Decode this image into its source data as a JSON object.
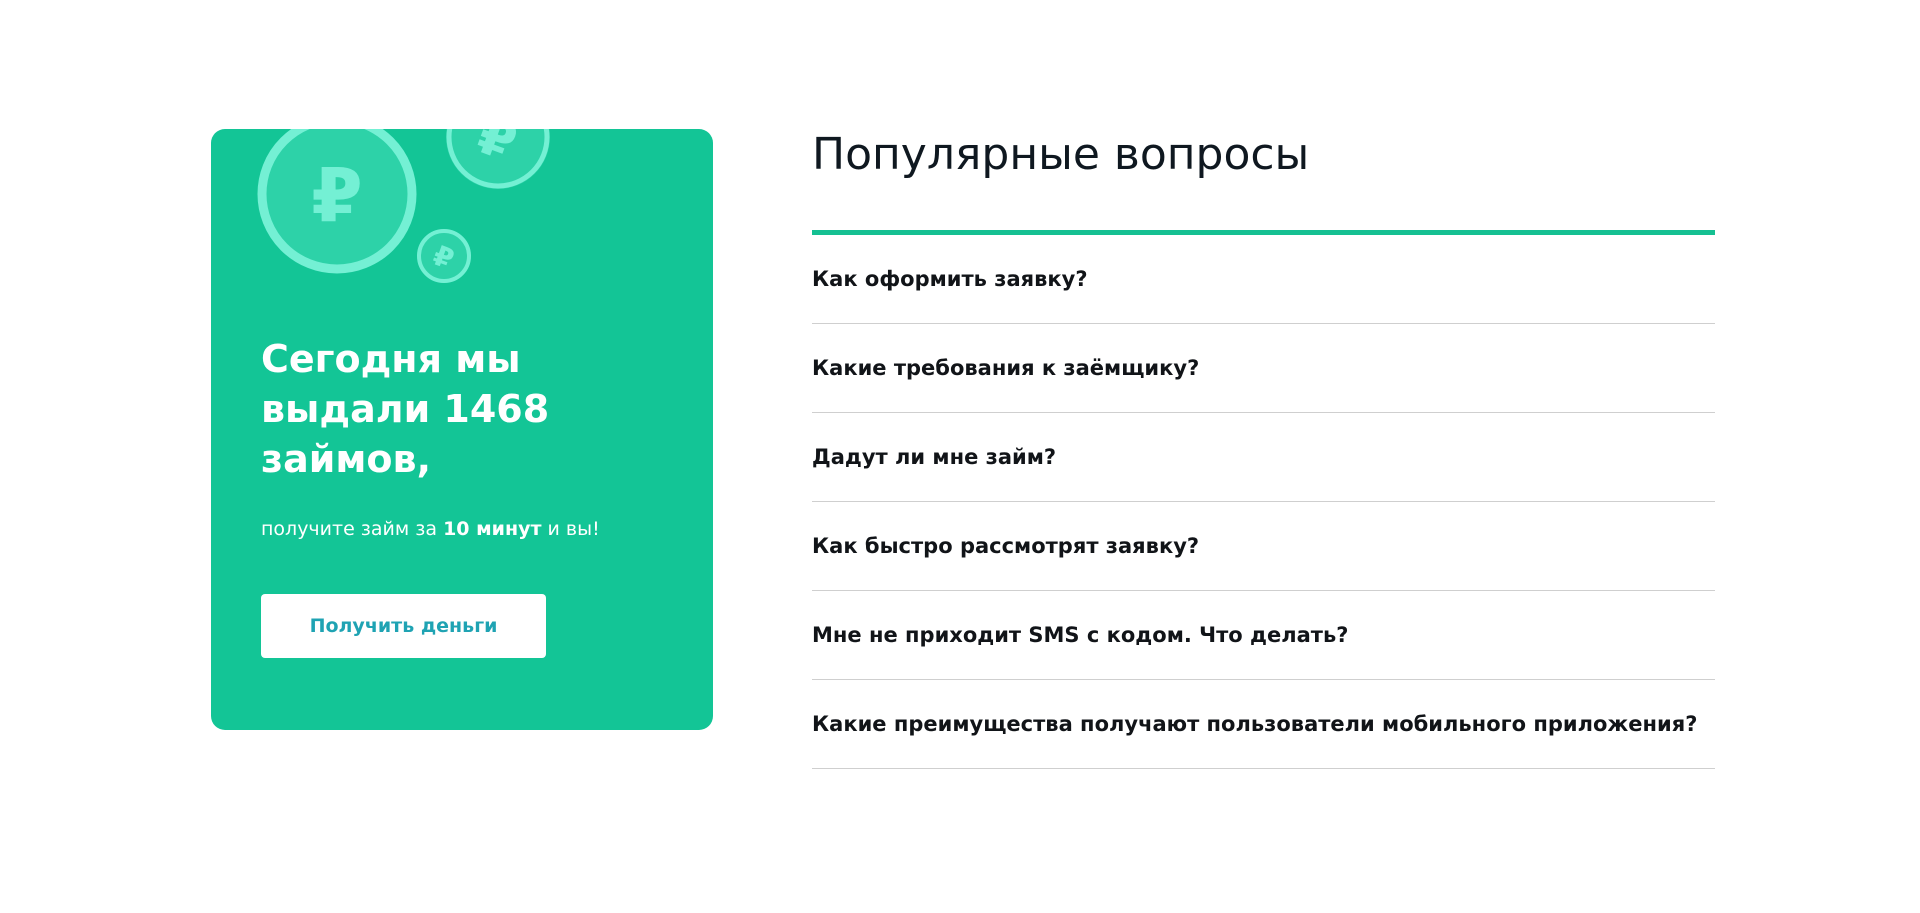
{
  "promo": {
    "title": "Сегодня мы выдали 1468 займов,",
    "subtitle_before": "получите займ за ",
    "subtitle_bold": "10 минут",
    "subtitle_after": " и вы!",
    "button_label": "Получить деньги",
    "icons": [
      "ruble-coin-icon",
      "ruble-coin-icon",
      "ruble-coin-icon"
    ]
  },
  "faq": {
    "title": "Популярные вопросы",
    "items": [
      "Как оформить заявку?",
      "Какие требования к заёмщику?",
      "Дадут ли мне займ?",
      "Как быстро рассмотрят заявку?",
      "Мне не приходит SMS с кодом. Что делать?",
      "Какие преимущества получают пользователи мобильного приложения?"
    ]
  },
  "colors": {
    "accent": "#13c596",
    "button_text": "#1fa3b3",
    "heading": "#0f1820",
    "divider": "#cfcfcf"
  }
}
